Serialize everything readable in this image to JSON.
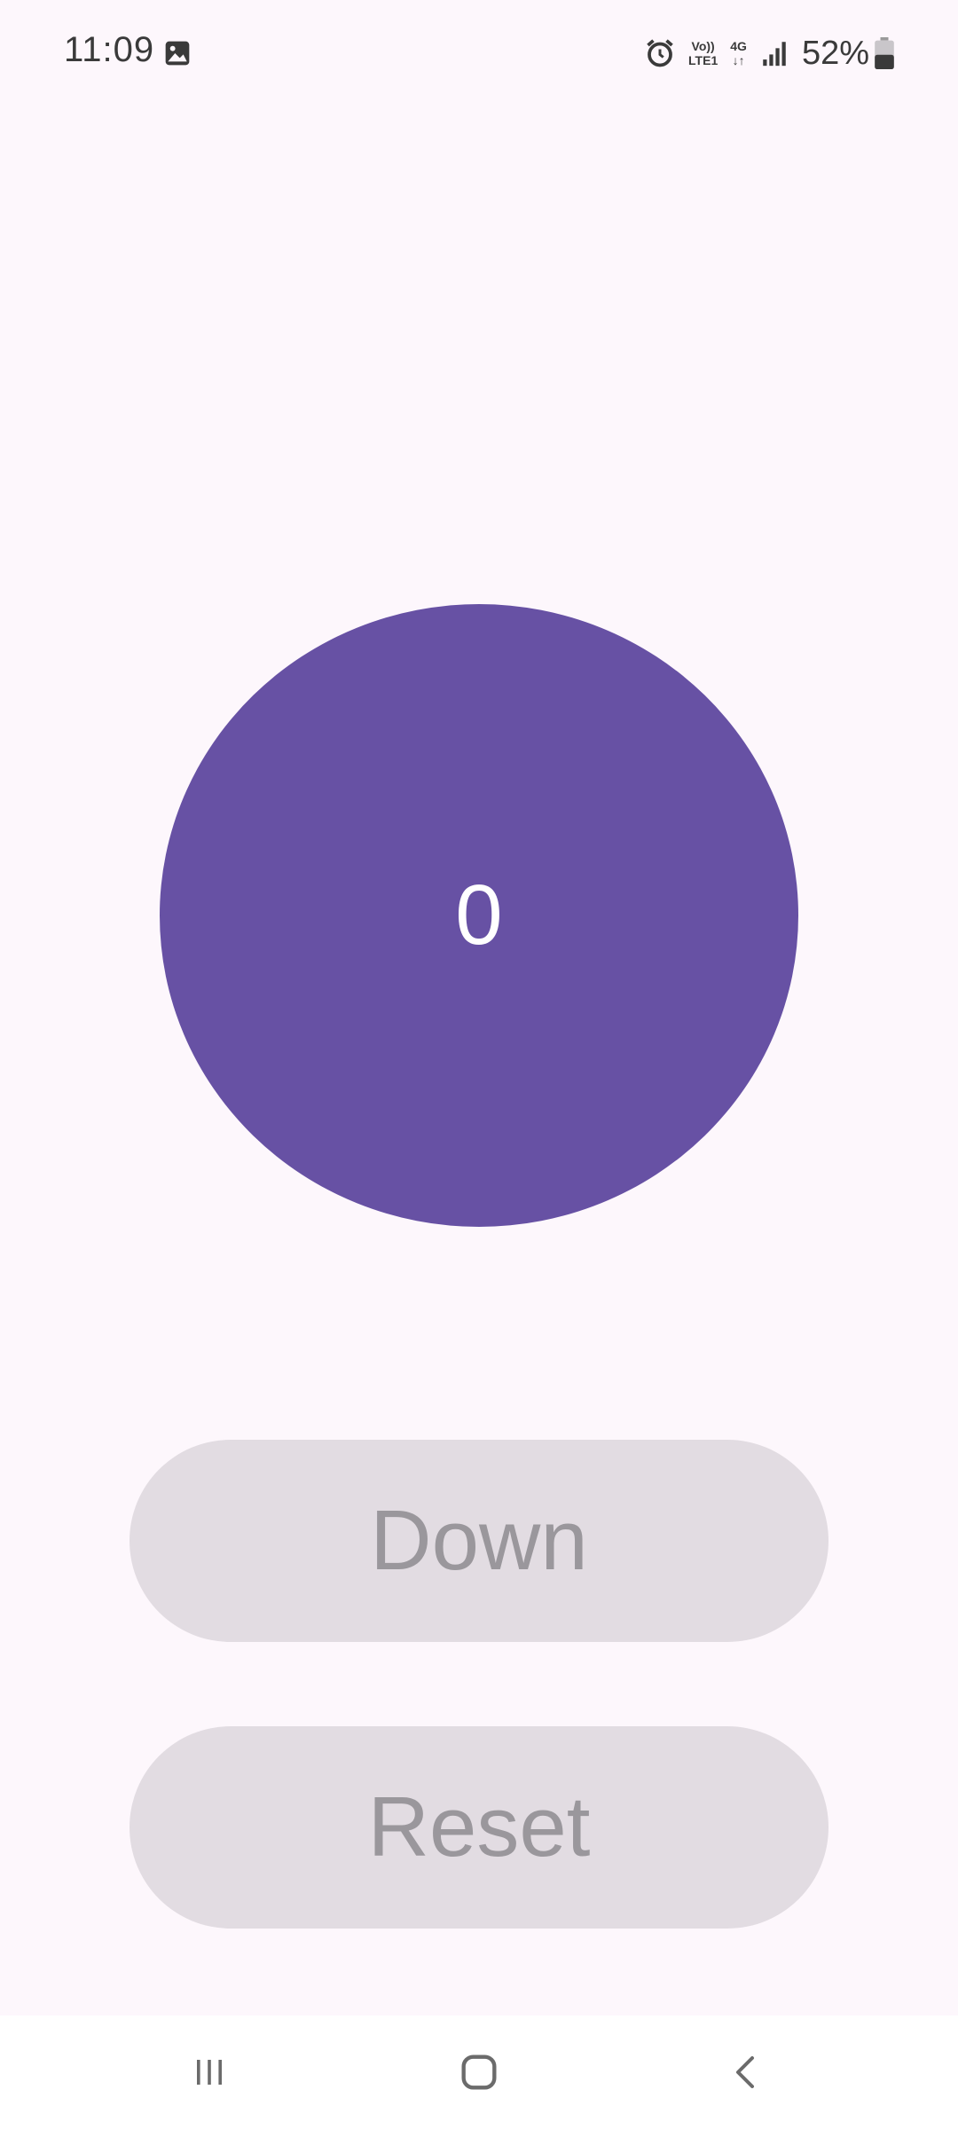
{
  "status_bar": {
    "time": "11:09",
    "volte_top": "Vo))",
    "volte_bottom": "LTE1",
    "network_type": "4G",
    "network_arrows": "↓↑",
    "battery_percent": "52%",
    "icons": [
      "gallery-icon",
      "alarm-icon",
      "volte-icon",
      "4g-icon",
      "signal-icon",
      "battery-icon"
    ]
  },
  "counter": {
    "value": "0",
    "color": "#6751A4"
  },
  "buttons": {
    "down_label": "Down",
    "reset_label": "Reset",
    "state": "disabled"
  },
  "nav_bar": {
    "icons": [
      "recents-icon",
      "home-icon",
      "back-icon"
    ]
  }
}
